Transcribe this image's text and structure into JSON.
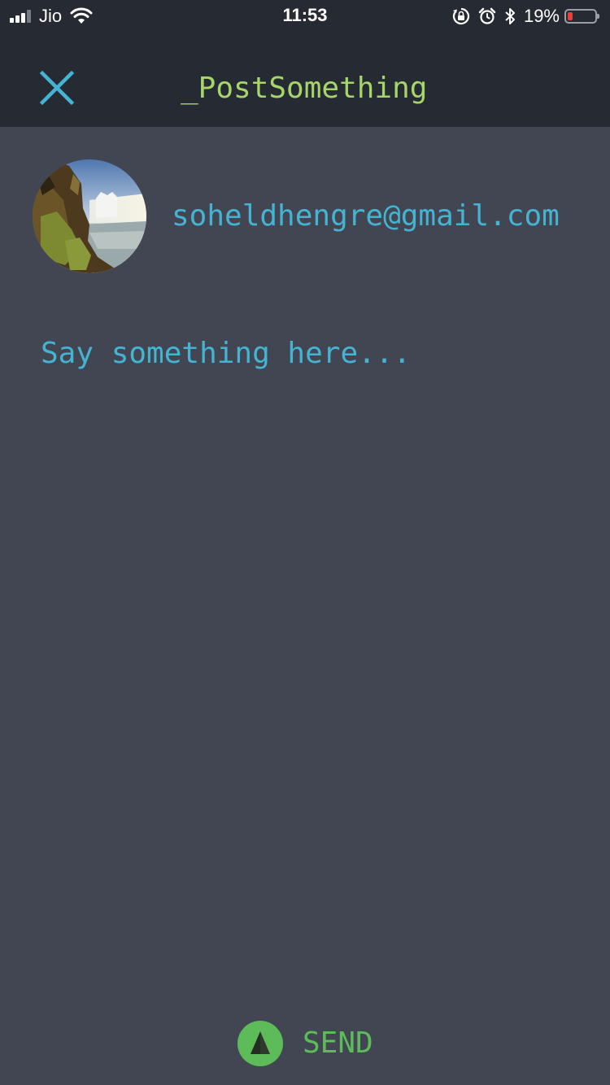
{
  "status_bar": {
    "carrier": "Jio",
    "time": "11:53",
    "battery_percent": "19%",
    "battery_level": 0.19,
    "signal_bars": 3,
    "icons": [
      "signal-icon",
      "wifi-icon",
      "rotation-lock-icon",
      "alarm-icon",
      "bluetooth-icon",
      "battery-icon"
    ]
  },
  "header": {
    "title": "_PostSomething",
    "close_icon": "close-icon"
  },
  "user": {
    "email": "soheldhengre@gmail.com",
    "avatar": "avatar-waterfall-photo"
  },
  "composer": {
    "placeholder": "Say something here...",
    "value": ""
  },
  "send": {
    "label": "SEND",
    "icon": "send-arrow-icon"
  },
  "colors": {
    "background": "#424652",
    "header_background": "#262a33",
    "accent_blue": "#45b4d3",
    "accent_green": "#a6d56a",
    "send_green": "#5dbb5a"
  }
}
